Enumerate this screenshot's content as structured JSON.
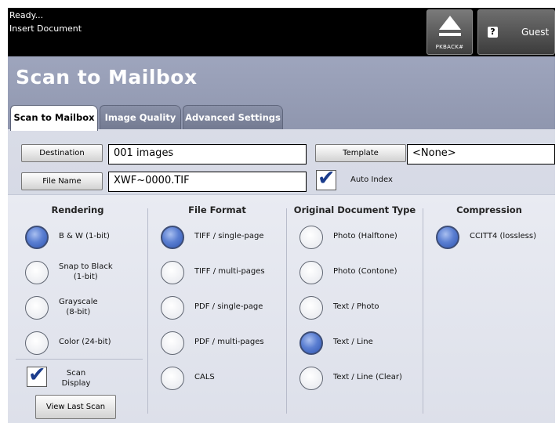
{
  "status": {
    "line1": "Ready...",
    "line2": "Insert Document",
    "pkback_label": "PKBACK#",
    "user_label": "Guest"
  },
  "page_title": "Scan to Mailbox",
  "tabs": [
    {
      "label": "Scan to Mailbox",
      "active": true
    },
    {
      "label": "Image Quality",
      "active": false
    },
    {
      "label": "Advanced Settings",
      "active": false
    }
  ],
  "fields": {
    "destination_button": "Destination",
    "destination_value": "001  images",
    "filename_button": "File Name",
    "filename_value": "XWF~0000.TIF",
    "template_button": "Template",
    "template_value": "<None>",
    "auto_index_label": "Auto Index",
    "auto_index_checked": true
  },
  "rendering": {
    "heading": "Rendering",
    "options": [
      {
        "line1": "B & W (1-bit)",
        "selected": true
      },
      {
        "line1": "Snap to Black",
        "line2": "(1-bit)",
        "selected": false
      },
      {
        "line1": "Grayscale",
        "line2": "(8-bit)",
        "selected": false
      },
      {
        "line1": "Color (24-bit)",
        "selected": false
      }
    ],
    "scan_display_line1": "Scan",
    "scan_display_line2": "Display",
    "scan_display_checked": true,
    "view_last_scan": "View Last Scan"
  },
  "file_format": {
    "heading": "File Format",
    "options": [
      {
        "label": "TIFF / single-page",
        "selected": true
      },
      {
        "label": "TIFF / multi-pages",
        "selected": false
      },
      {
        "label": "PDF / single-page",
        "selected": false
      },
      {
        "label": "PDF / multi-pages",
        "selected": false
      },
      {
        "label": "CALS",
        "selected": false
      }
    ]
  },
  "doc_type": {
    "heading": "Original Document Type",
    "options": [
      {
        "label": "Photo (Halftone)",
        "selected": false
      },
      {
        "label": "Photo (Contone)",
        "selected": false
      },
      {
        "label": "Text / Photo",
        "selected": false
      },
      {
        "label": "Text / Line",
        "selected": true
      },
      {
        "label": "Text / Line (Clear)",
        "selected": false
      }
    ]
  },
  "compression": {
    "heading": "Compression",
    "options": [
      {
        "label": "CCITT4 (lossless)",
        "selected": true
      }
    ]
  },
  "colors": {
    "accent": "#2f55b0",
    "title_bg": "#9ea5bd",
    "status_bg": "#000000"
  },
  "icons": {
    "pkback": "eject-icon",
    "user": "question-user-icon",
    "check": "checkmark-icon"
  }
}
